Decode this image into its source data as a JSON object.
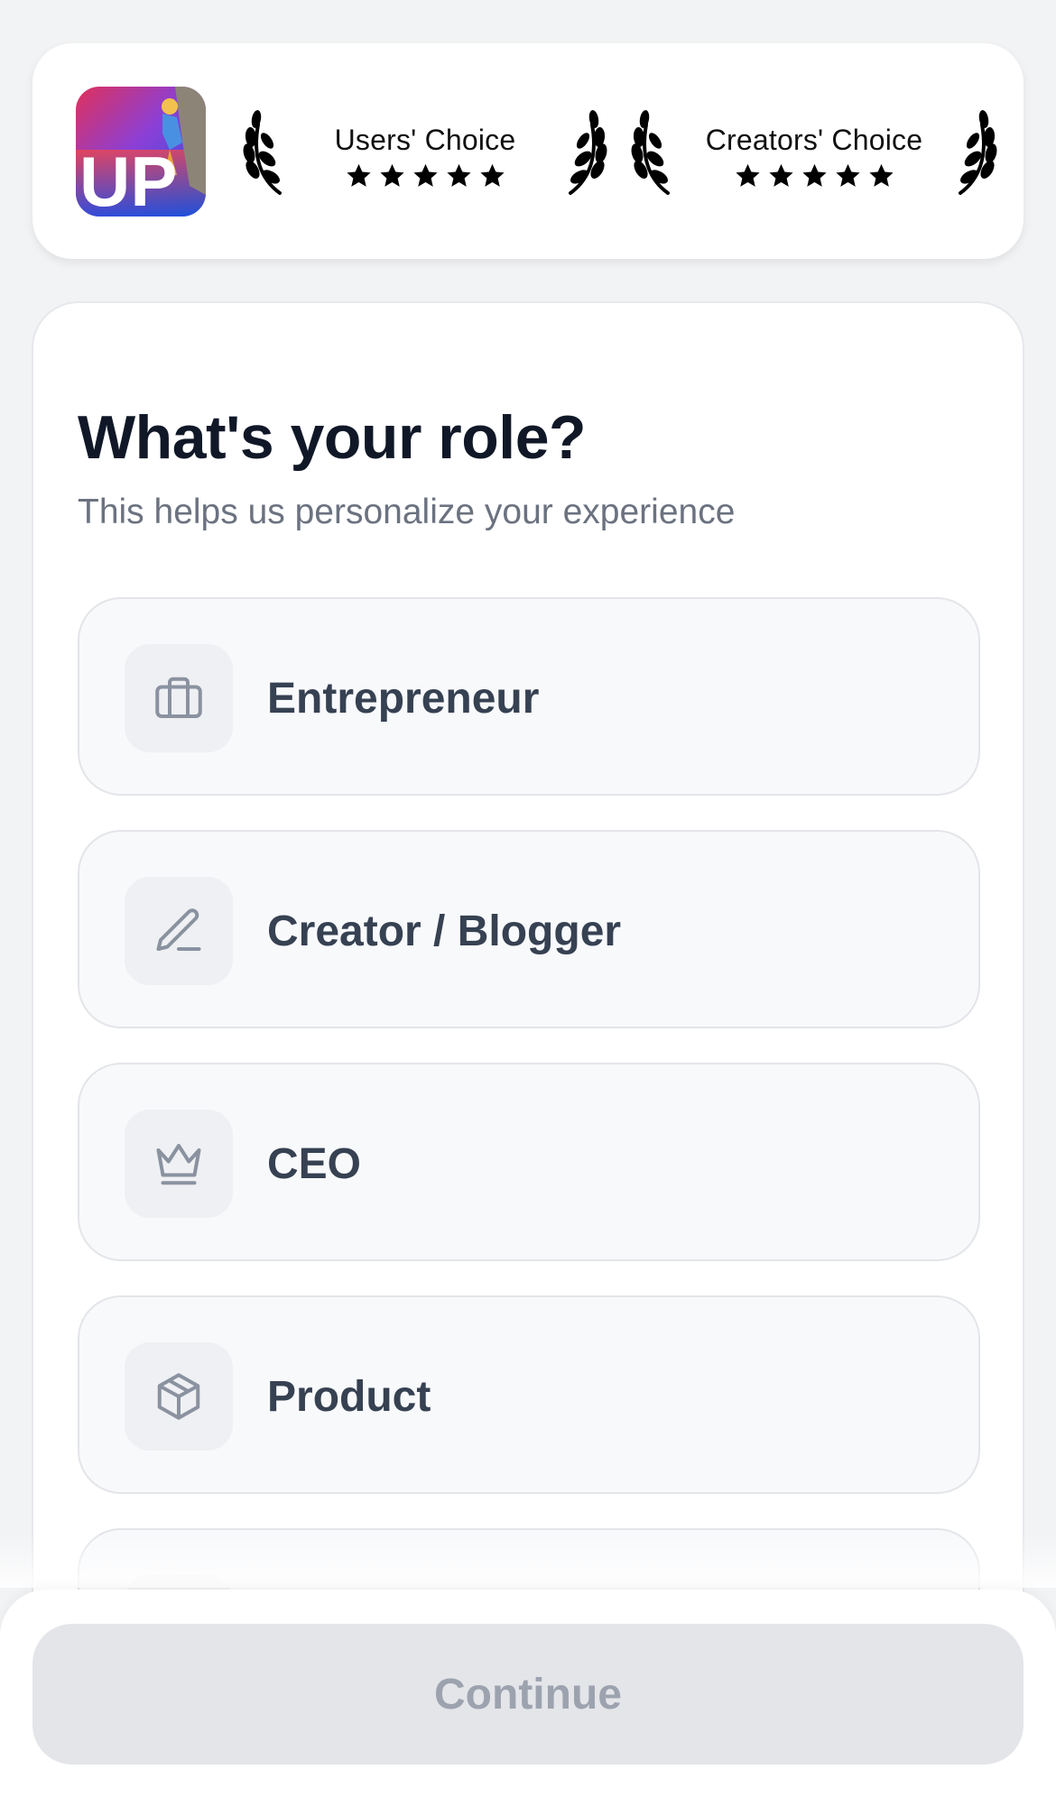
{
  "awards": [
    {
      "title": "Users' Choice",
      "stars": 5
    },
    {
      "title": "Creators' Choice",
      "stars": 5
    }
  ],
  "app_logo": {
    "text": "UP"
  },
  "heading": "What's your role?",
  "subheading": "This helps us personalize your experience",
  "roles": [
    {
      "label": "Entrepreneur",
      "icon": "briefcase-icon"
    },
    {
      "label": "Creator / Blogger",
      "icon": "pen-icon"
    },
    {
      "label": "CEO",
      "icon": "crown-icon"
    },
    {
      "label": "Product",
      "icon": "box-icon"
    },
    {
      "label": "",
      "icon": "role-icon"
    }
  ],
  "continue_label": "Continue",
  "colors": {
    "background": "#f2f3f5",
    "card": "#ffffff",
    "option_bg": "#f8f9fb",
    "option_border": "#e3e5e9",
    "title": "#101828",
    "subtitle": "#6b7280",
    "label": "#364152",
    "button_disabled_bg": "#e4e5e9",
    "button_disabled_text": "#9ca3af"
  }
}
